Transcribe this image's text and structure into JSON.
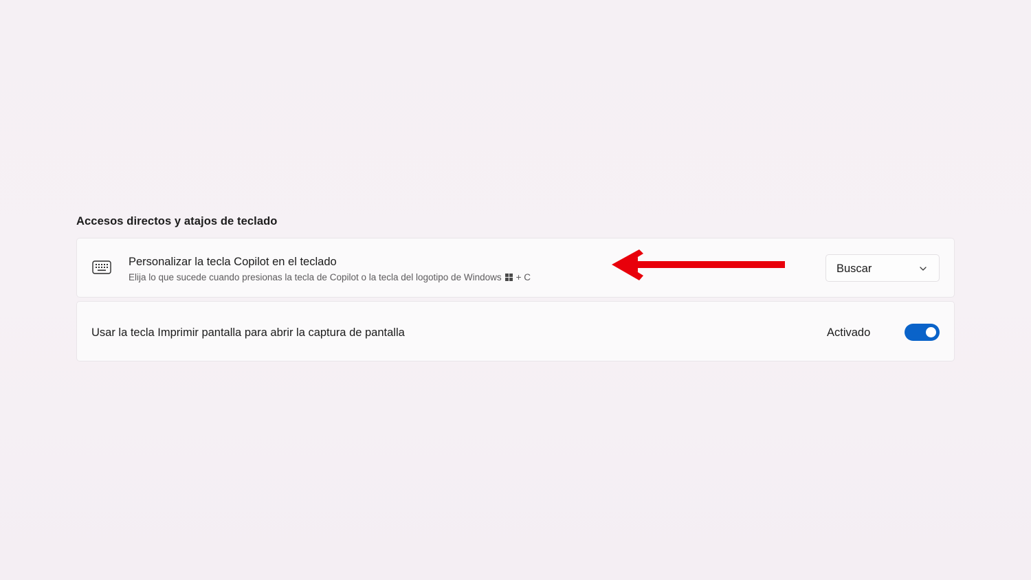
{
  "section": {
    "title": "Accesos directos y atajos de teclado"
  },
  "copilot_setting": {
    "icon": "keyboard-icon",
    "title": "Personalizar la tecla Copilot en el teclado",
    "description_before": "Elija lo que sucede cuando presionas la tecla de Copilot o la tecla del logotipo de Windows",
    "description_logo_icon": "windows-logo-icon",
    "description_after": "+ C",
    "dropdown": {
      "selected": "Buscar",
      "icon": "chevron-down-icon"
    }
  },
  "print_screen_setting": {
    "label": "Usar la tecla Imprimir pantalla para abrir la captura de pantalla",
    "toggle_state_label": "Activado",
    "toggle_on": true
  },
  "annotation": {
    "icon": "red-arrow-left",
    "color": "#e8000b"
  },
  "colors": {
    "accent": "#0a63c9",
    "annotation_red": "#e8000b"
  }
}
